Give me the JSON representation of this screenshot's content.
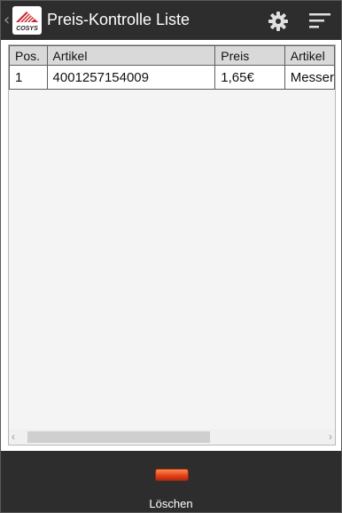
{
  "header": {
    "title": "Preis-Kontrolle Liste",
    "logo_text": "COSYS",
    "icons": {
      "back": "chevron-left-icon",
      "settings": "gear-icon",
      "menu": "sort-menu-icon"
    }
  },
  "table": {
    "columns": [
      "Pos.",
      "Artikel",
      "Preis",
      "Artikel"
    ],
    "rows": [
      [
        "1",
        "4001257154009",
        "1,65€",
        "Messer"
      ]
    ]
  },
  "footer": {
    "delete_label": "Löschen"
  },
  "colors": {
    "header_bg": "#2d2d2d",
    "accent": "#e0401a"
  }
}
